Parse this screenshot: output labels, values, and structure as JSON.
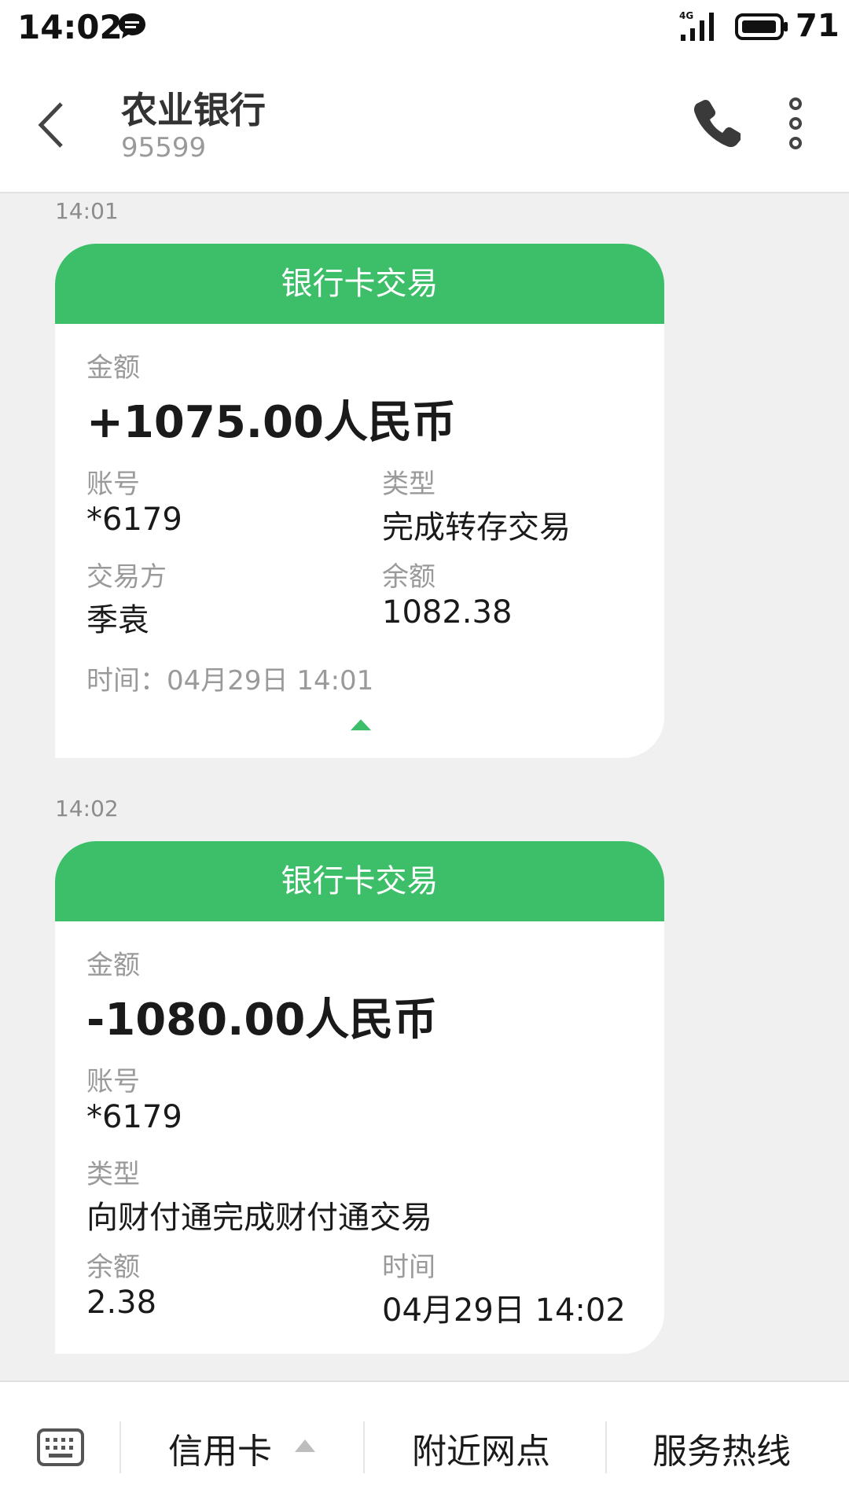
{
  "status_bar": {
    "time": "14:02",
    "network": "4G",
    "battery": "71"
  },
  "header": {
    "title": "农业银行",
    "number": "95599"
  },
  "messages": [
    {
      "timestamp": "14:01",
      "card_title": "银行卡交易",
      "amount_label": "金额",
      "amount": "+1075.00人民币",
      "account_label": "账号",
      "account": "*6179",
      "type_label": "类型",
      "type": "完成转存交易",
      "counterparty_label": "交易方",
      "counterparty": "季袁",
      "balance_label": "余额",
      "balance": "1082.38",
      "time_line": "时间：04月29日 14:01"
    },
    {
      "timestamp": "14:02",
      "card_title": "银行卡交易",
      "amount_label": "金额",
      "amount": "-1080.00人民币",
      "account_label": "账号",
      "account": "*6179",
      "type_label": "类型",
      "type": "向财付通完成财付通交易",
      "balance_label": "余额",
      "balance": "2.38",
      "time_label": "时间",
      "time": "04月29日 14:02"
    }
  ],
  "bottom_menu": {
    "item1": "信用卡",
    "item2": "附近网点",
    "item3": "服务热线"
  },
  "colors": {
    "accent": "#3dbf6a",
    "background": "#f0f0f0"
  }
}
